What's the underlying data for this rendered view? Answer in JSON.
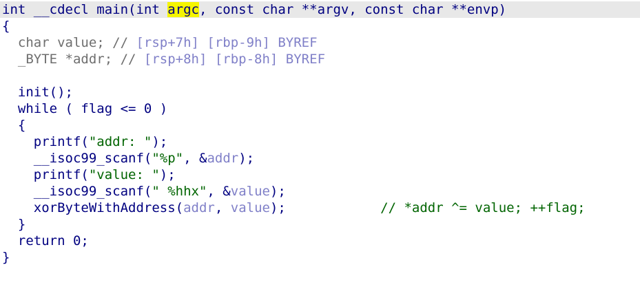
{
  "lines": [
    {
      "id": "sig",
      "segments": [
        {
          "text": "int __cdecl main(int ",
          "cls": "kw"
        },
        {
          "text": "argc",
          "cls": "kw hl"
        },
        {
          "text": ", const char **argv, const char **envp)",
          "cls": "kw"
        }
      ]
    },
    {
      "id": "open-main",
      "segments": [
        {
          "text": "{",
          "cls": "kw"
        }
      ]
    },
    {
      "id": "decl-value",
      "segments": [
        {
          "text": "  char value; // ",
          "cls": "gray"
        },
        {
          "text": "[rsp+7h] [rbp-9h] BYREF",
          "cls": "cmt2"
        }
      ]
    },
    {
      "id": "decl-addr",
      "segments": [
        {
          "text": "  _BYTE *addr; // ",
          "cls": "gray"
        },
        {
          "text": "[rsp+8h] [rbp-8h] BYREF",
          "cls": "cmt2"
        }
      ]
    },
    {
      "id": "blank",
      "segments": [
        {
          "text": "",
          "cls": "kw"
        }
      ]
    },
    {
      "id": "init-call",
      "segments": [
        {
          "text": "  init();",
          "cls": "kw"
        }
      ]
    },
    {
      "id": "while-loop",
      "segments": [
        {
          "text": "  while ( flag <= 0 )",
          "cls": "kw"
        }
      ]
    },
    {
      "id": "open-loop",
      "segments": [
        {
          "text": "  {",
          "cls": "kw"
        }
      ]
    },
    {
      "id": "printf-addr",
      "segments": [
        {
          "text": "    printf(",
          "cls": "kw"
        },
        {
          "text": "\"addr: \"",
          "cls": "str"
        },
        {
          "text": ");",
          "cls": "kw"
        }
      ]
    },
    {
      "id": "scanf-addr",
      "segments": [
        {
          "text": "    __isoc99_scanf(",
          "cls": "kw"
        },
        {
          "text": "\"%p\"",
          "cls": "str"
        },
        {
          "text": ", &",
          "cls": "kw"
        },
        {
          "text": "addr",
          "cls": "var"
        },
        {
          "text": ");",
          "cls": "kw"
        }
      ]
    },
    {
      "id": "printf-value",
      "segments": [
        {
          "text": "    printf(",
          "cls": "kw"
        },
        {
          "text": "\"value: \"",
          "cls": "str"
        },
        {
          "text": ");",
          "cls": "kw"
        }
      ]
    },
    {
      "id": "scanf-value",
      "segments": [
        {
          "text": "    __isoc99_scanf(",
          "cls": "kw"
        },
        {
          "text": "\" %hhx\"",
          "cls": "str"
        },
        {
          "text": ", &",
          "cls": "kw"
        },
        {
          "text": "value",
          "cls": "var"
        },
        {
          "text": ");",
          "cls": "kw"
        }
      ]
    },
    {
      "id": "xor-call",
      "segments": [
        {
          "text": "    xorByteWithAddress(",
          "cls": "kw"
        },
        {
          "text": "addr",
          "cls": "var"
        },
        {
          "text": ", ",
          "cls": "kw"
        },
        {
          "text": "value",
          "cls": "var"
        },
        {
          "text": ");            ",
          "cls": "kw"
        },
        {
          "text": "// *addr ^= value; ++flag;",
          "cls": "cmt"
        }
      ]
    },
    {
      "id": "close-loop",
      "segments": [
        {
          "text": "  }",
          "cls": "kw"
        }
      ]
    },
    {
      "id": "return",
      "segments": [
        {
          "text": "  return 0;",
          "cls": "kw"
        }
      ]
    },
    {
      "id": "close-main",
      "segments": [
        {
          "text": "}",
          "cls": "kw"
        }
      ]
    }
  ]
}
